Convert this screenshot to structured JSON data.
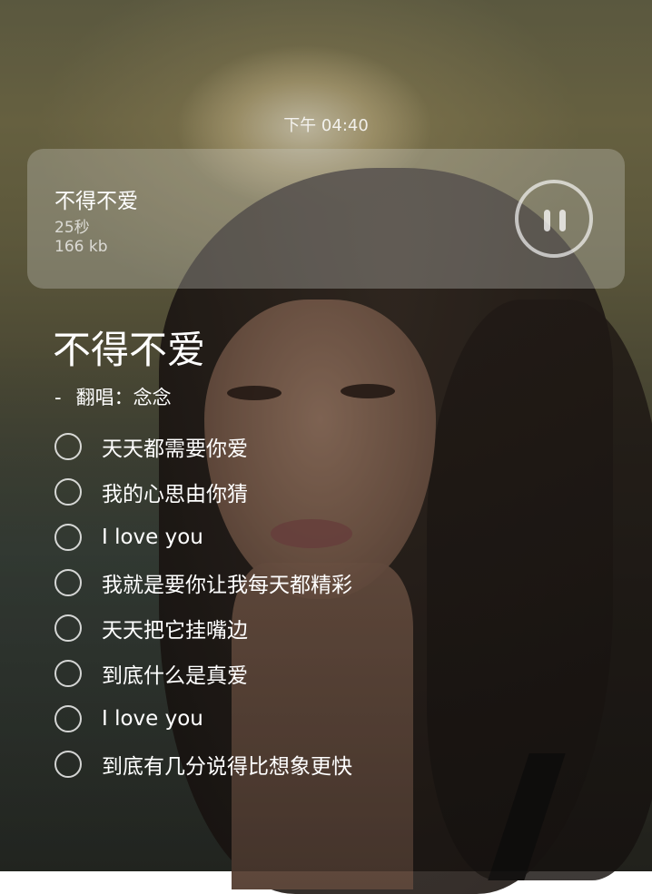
{
  "status": {
    "time": "下午 04:40"
  },
  "player": {
    "title": "不得不爱",
    "duration": "25秒",
    "size": "166 kb",
    "control_icon": "pause-icon"
  },
  "song": {
    "title": "不得不爱",
    "singer_prefix": "-",
    "singer": "翻唱：念念"
  },
  "lyrics": [
    "天天都需要你爱",
    "我的心思由你猜",
    "I love you",
    "我就是要你让我每天都精彩",
    "天天把它挂嘴边",
    "到底什么是真爱",
    "I love you",
    "到底有几分说得比想象更快"
  ],
  "colors": {
    "text": "#ffffff",
    "card_background": "rgba(205,205,200,0.32)",
    "accent": "#ffffff"
  }
}
